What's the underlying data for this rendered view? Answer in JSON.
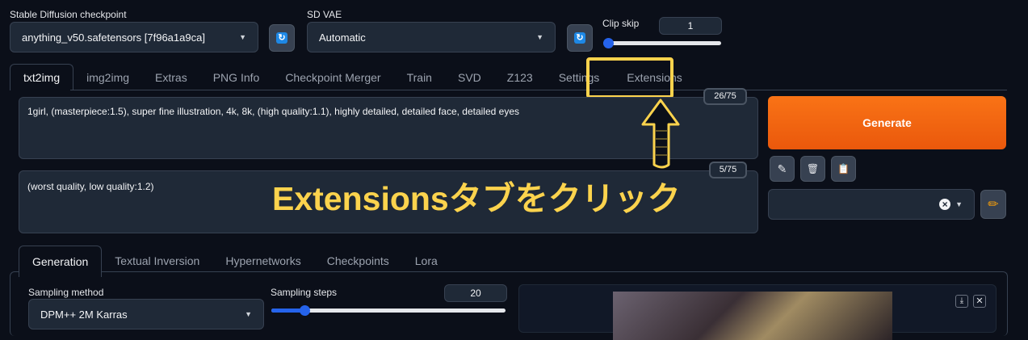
{
  "checkpoint": {
    "label": "Stable Diffusion checkpoint",
    "value": "anything_v50.safetensors [7f96a1a9ca]"
  },
  "vae": {
    "label": "SD VAE",
    "value": "Automatic"
  },
  "clip_skip": {
    "label": "Clip skip",
    "value": "1",
    "fraction": 0.0
  },
  "tabs": [
    {
      "label": "txt2img"
    },
    {
      "label": "img2img"
    },
    {
      "label": "Extras"
    },
    {
      "label": "PNG Info"
    },
    {
      "label": "Checkpoint Merger"
    },
    {
      "label": "Train"
    },
    {
      "label": "SVD"
    },
    {
      "label": "Z123"
    },
    {
      "label": "Settings"
    },
    {
      "label": "Extensions"
    }
  ],
  "prompt": {
    "text": "1girl, (masterpiece:1.5), super fine illustration, 4k, 8k, (high quality:1.1), highly detailed, detailed face, detailed eyes",
    "counter": "26/75"
  },
  "negative_prompt": {
    "text": "(worst quality, low quality:1.2)",
    "counter": "5/75"
  },
  "generate_label": "Generate",
  "tools": {
    "pencil_icon": "✎",
    "trash_icon": "🗑",
    "clipboard_icon": "📋"
  },
  "style_select": {
    "clear_icon": "×"
  },
  "annotation": {
    "text": "Extensionsタブをクリック",
    "color": "#fcd34d"
  },
  "subtabs": [
    {
      "label": "Generation"
    },
    {
      "label": "Textual Inversion"
    },
    {
      "label": "Hypernetworks"
    },
    {
      "label": "Checkpoints"
    },
    {
      "label": "Lora"
    }
  ],
  "sampling_method": {
    "label": "Sampling method",
    "value": "DPM++ 2M Karras"
  },
  "sampling_steps": {
    "label": "Sampling steps",
    "value": "20",
    "fraction": 0.13
  },
  "colors": {
    "accent": "#f97316",
    "slider": "#2563eb",
    "bg": "#0b0f19",
    "highlight": "#fcd34d"
  }
}
